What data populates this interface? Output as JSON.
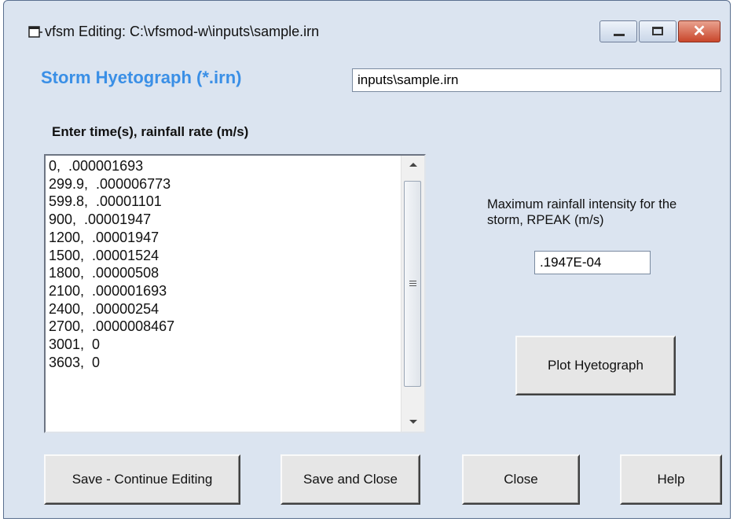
{
  "window": {
    "title": "vfsm Editing: C:\\vfsmod-w\\inputs\\sample.irn"
  },
  "icons": {
    "app": "app-window-icon",
    "minimize": "minimize-icon",
    "maximize": "maximize-icon",
    "close": "close-icon"
  },
  "colors": {
    "accent_label": "#3a8fe6",
    "window_bg": "#dbe4f0",
    "close_button": "#c9462b"
  },
  "storm": {
    "label": "Storm Hyetograph (*.irn)",
    "file_value": "inputs\\sample.irn"
  },
  "rainfall": {
    "label": "Enter time(s), rainfall rate (m/s)",
    "lines": [
      "0,  .000001693",
      "299.9,  .000006773",
      "599.8,  .00001101",
      "900,  .00001947",
      "1200,  .00001947",
      "1500,  .00001524",
      "1800,  .00000508",
      "2100,  .000001693",
      "2400,  .00000254",
      "2700,  .0000008467",
      "3001,  0",
      "3603,  0"
    ]
  },
  "rpeak": {
    "label": "Maximum rainfall intensity for the storm, RPEAK (m/s)",
    "value": ".1947E-04"
  },
  "buttons": {
    "plot": "Plot Hyetograph",
    "save_continue": "Save - Continue Editing",
    "save_close": "Save and Close",
    "close": "Close",
    "help": "Help"
  }
}
